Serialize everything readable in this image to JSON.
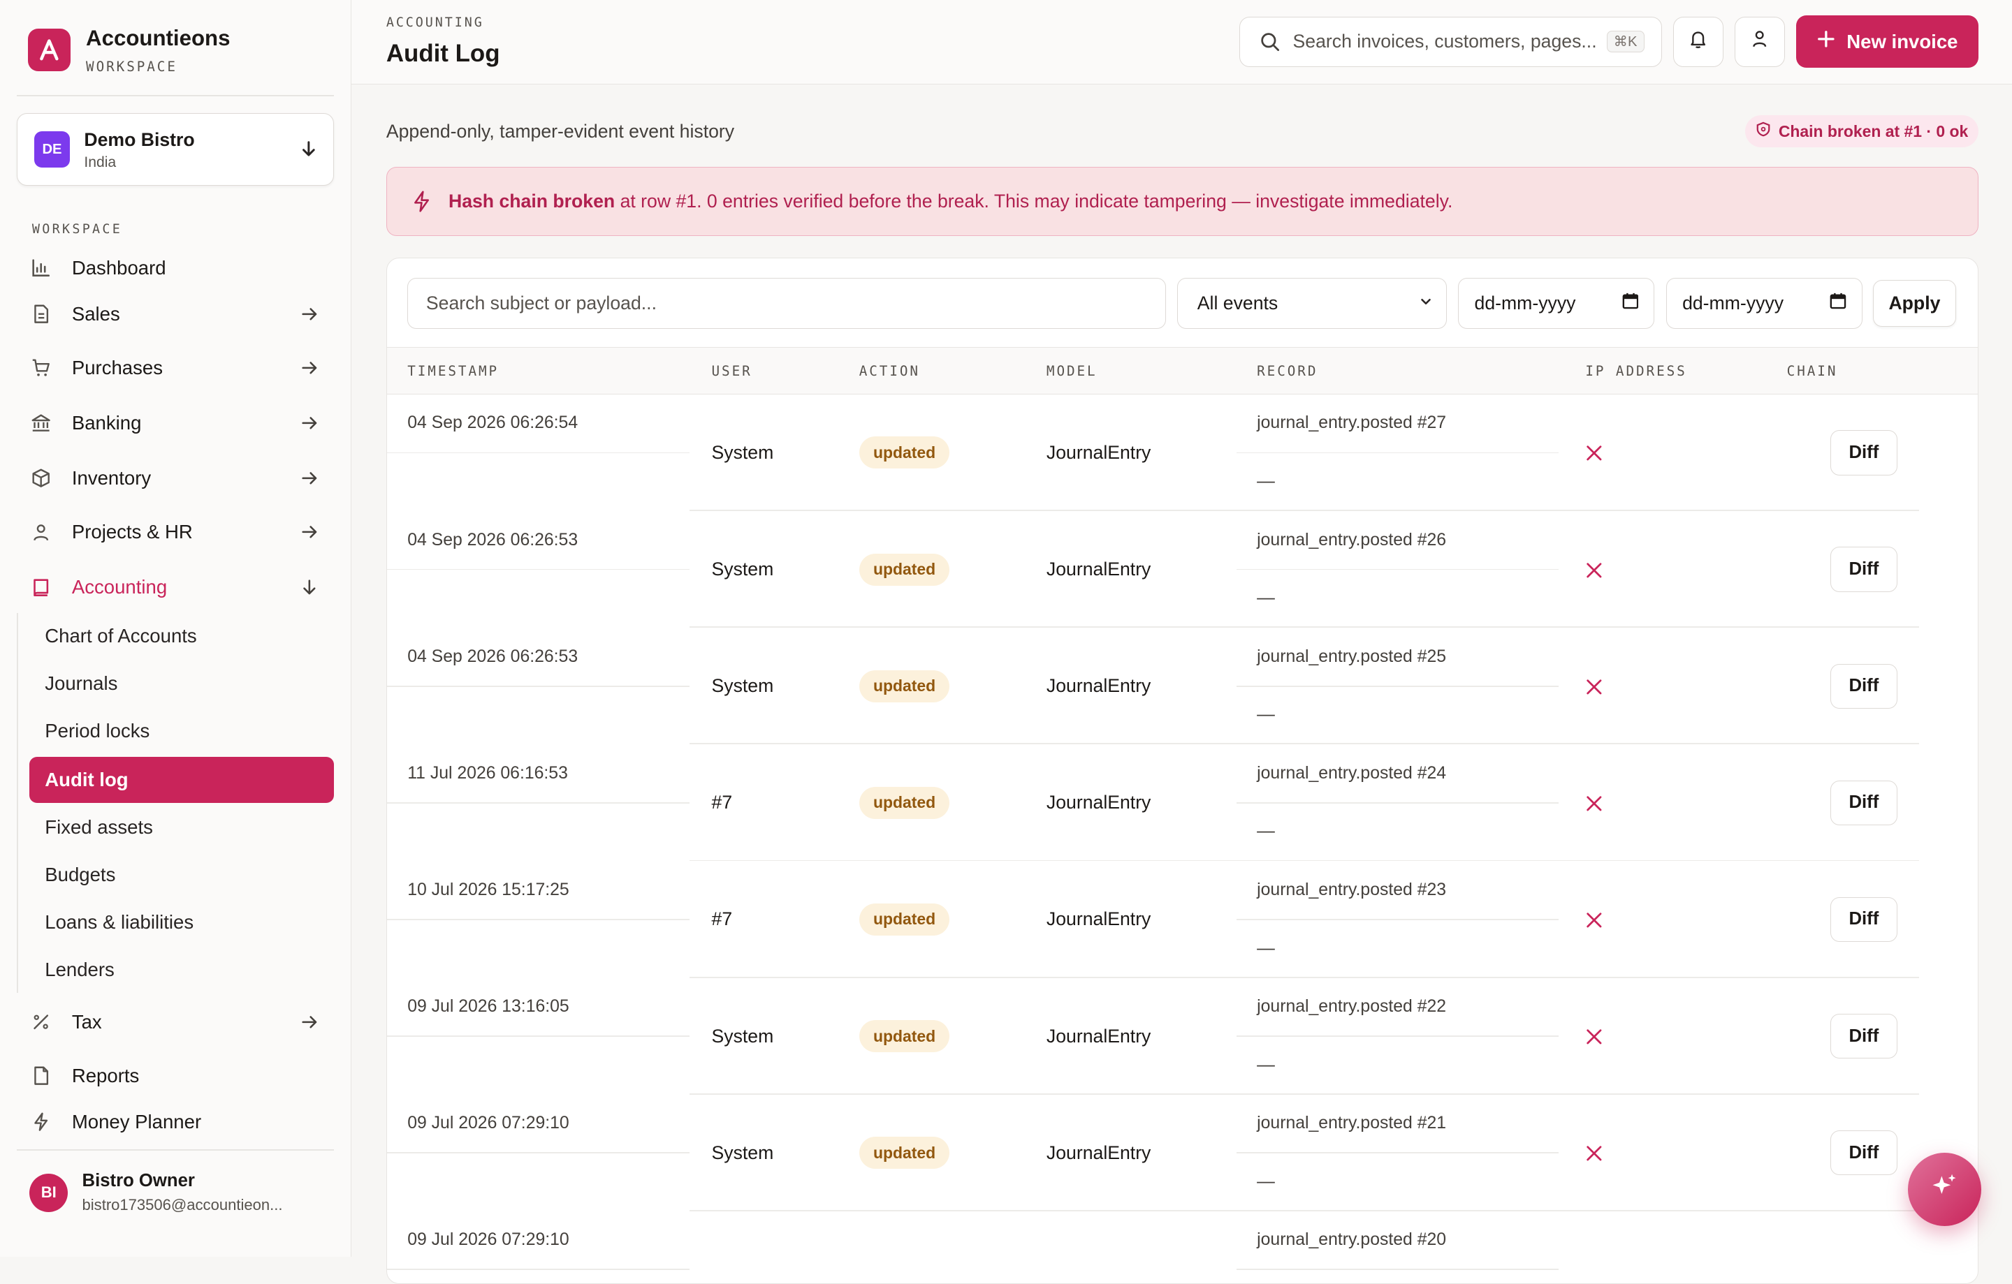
{
  "app": {
    "name": "Accountieons",
    "subtitle": "WORKSPACE"
  },
  "org": {
    "initials": "DE",
    "name": "Demo Bistro",
    "country": "India"
  },
  "sidebar": {
    "section": "WORKSPACE",
    "items": [
      {
        "label": "Dashboard"
      },
      {
        "label": "Sales"
      },
      {
        "label": "Purchases"
      },
      {
        "label": "Banking"
      },
      {
        "label": "Inventory"
      },
      {
        "label": "Projects & HR"
      },
      {
        "label": "Accounting"
      },
      {
        "label": "Tax"
      },
      {
        "label": "Reports"
      },
      {
        "label": "Money Planner"
      }
    ],
    "accounting_sub": [
      {
        "label": "Chart of Accounts"
      },
      {
        "label": "Journals"
      },
      {
        "label": "Period locks"
      },
      {
        "label": "Audit log"
      },
      {
        "label": "Fixed assets"
      },
      {
        "label": "Budgets"
      },
      {
        "label": "Loans & liabilities"
      },
      {
        "label": "Lenders"
      }
    ]
  },
  "user": {
    "initials": "BI",
    "name": "Bistro Owner",
    "email": "bistro173506@accountieon..."
  },
  "header": {
    "breadcrumb": "ACCOUNTING",
    "title": "Audit Log",
    "search_placeholder": "Search invoices, customers, pages...",
    "search_shortcut": "⌘K",
    "new_invoice_label": "New invoice"
  },
  "main": {
    "subtitle": "Append-only, tamper-evident event history",
    "chain_status": "Chain broken at #1 · 0 ok",
    "alert": {
      "strong": "Hash chain broken",
      "text": " at row #1. 0 entries verified before the break. This may indicate tampering — investigate immediately."
    },
    "filters": {
      "search_placeholder": "Search subject or payload...",
      "event_select": "All events",
      "date_from": "dd-mm-yyyy",
      "date_to": "dd-mm-yyyy",
      "apply_label": "Apply"
    },
    "columns": [
      "TIMESTAMP",
      "USER",
      "ACTION",
      "MODEL",
      "RECORD",
      "IP ADDRESS",
      "CHAIN"
    ],
    "rows": [
      {
        "timestamp": "04 Sep 2026 06:26:54",
        "user": "System",
        "action": "updated",
        "model": "JournalEntry",
        "record": "journal_entry.posted #27",
        "ip": "—",
        "diff": "Diff"
      },
      {
        "timestamp": "04 Sep 2026 06:26:53",
        "user": "System",
        "action": "updated",
        "model": "JournalEntry",
        "record": "journal_entry.posted #26",
        "ip": "—",
        "diff": "Diff"
      },
      {
        "timestamp": "04 Sep 2026 06:26:53",
        "user": "System",
        "action": "updated",
        "model": "JournalEntry",
        "record": "journal_entry.posted #25",
        "ip": "—",
        "diff": "Diff"
      },
      {
        "timestamp": "11 Jul 2026 06:16:53",
        "user": "#7",
        "action": "updated",
        "model": "JournalEntry",
        "record": "journal_entry.posted #24",
        "ip": "—",
        "diff": "Diff"
      },
      {
        "timestamp": "10 Jul 2026 15:17:25",
        "user": "#7",
        "action": "updated",
        "model": "JournalEntry",
        "record": "journal_entry.posted #23",
        "ip": "—",
        "diff": "Diff"
      },
      {
        "timestamp": "09 Jul 2026 13:16:05",
        "user": "System",
        "action": "updated",
        "model": "JournalEntry",
        "record": "journal_entry.posted #22",
        "ip": "—",
        "diff": "Diff"
      },
      {
        "timestamp": "09 Jul 2026 07:29:10",
        "user": "System",
        "action": "updated",
        "model": "JournalEntry",
        "record": "journal_entry.posted #21",
        "ip": "—",
        "diff": "Diff"
      },
      {
        "timestamp": "09 Jul 2026 07:29:10",
        "user": "",
        "action": "",
        "model": "",
        "record": "journal_entry.posted #20",
        "ip": "",
        "diff": ""
      }
    ]
  },
  "colors": {
    "accent": "#c9245a",
    "alert_bg": "#f9e1e3",
    "badge_bg": "#fcf1dc"
  }
}
